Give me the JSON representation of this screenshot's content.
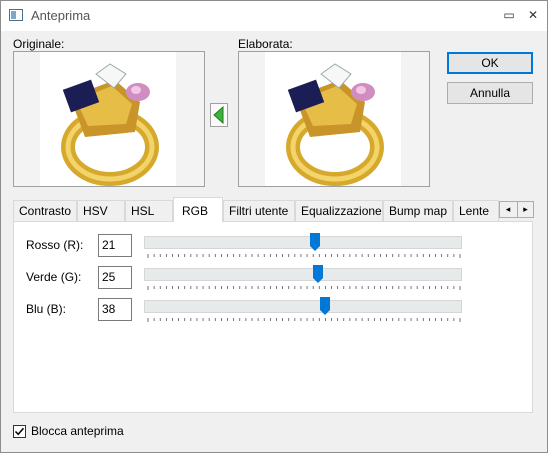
{
  "window": {
    "title": "Anteprima",
    "minimize_glyph": "▭",
    "close_glyph": "✕"
  },
  "preview": {
    "original_label": "Originale:",
    "processed_label": "Elaborata:",
    "copy_arrow_icon": "arrow-left-icon"
  },
  "buttons": {
    "ok_label": "OK",
    "cancel_label": "Annulla"
  },
  "tabs": [
    {
      "label": "Contrasto"
    },
    {
      "label": "HSV"
    },
    {
      "label": "HSL"
    },
    {
      "label": "RGB",
      "active": true
    },
    {
      "label": "Filtri utente"
    },
    {
      "label": "Equalizzazione"
    },
    {
      "label": "Bump map"
    },
    {
      "label": "Lente"
    }
  ],
  "tab_scroll": {
    "left_glyph": "◂",
    "right_glyph": "▸"
  },
  "rgb": {
    "red": {
      "label": "Rosso (R):",
      "value": "21",
      "slider_fraction": 0.54
    },
    "green": {
      "label": "Verde (G):",
      "value": "25",
      "slider_fraction": 0.55
    },
    "blue": {
      "label": "Blu (B):",
      "value": "38",
      "slider_fraction": 0.57
    }
  },
  "lock_preview": {
    "label": "Blocca anteprima",
    "checked": true
  },
  "colors": {
    "accent": "#0078d7",
    "arrow_green": "#3cb43c",
    "slider_track": "#e7eaea"
  }
}
